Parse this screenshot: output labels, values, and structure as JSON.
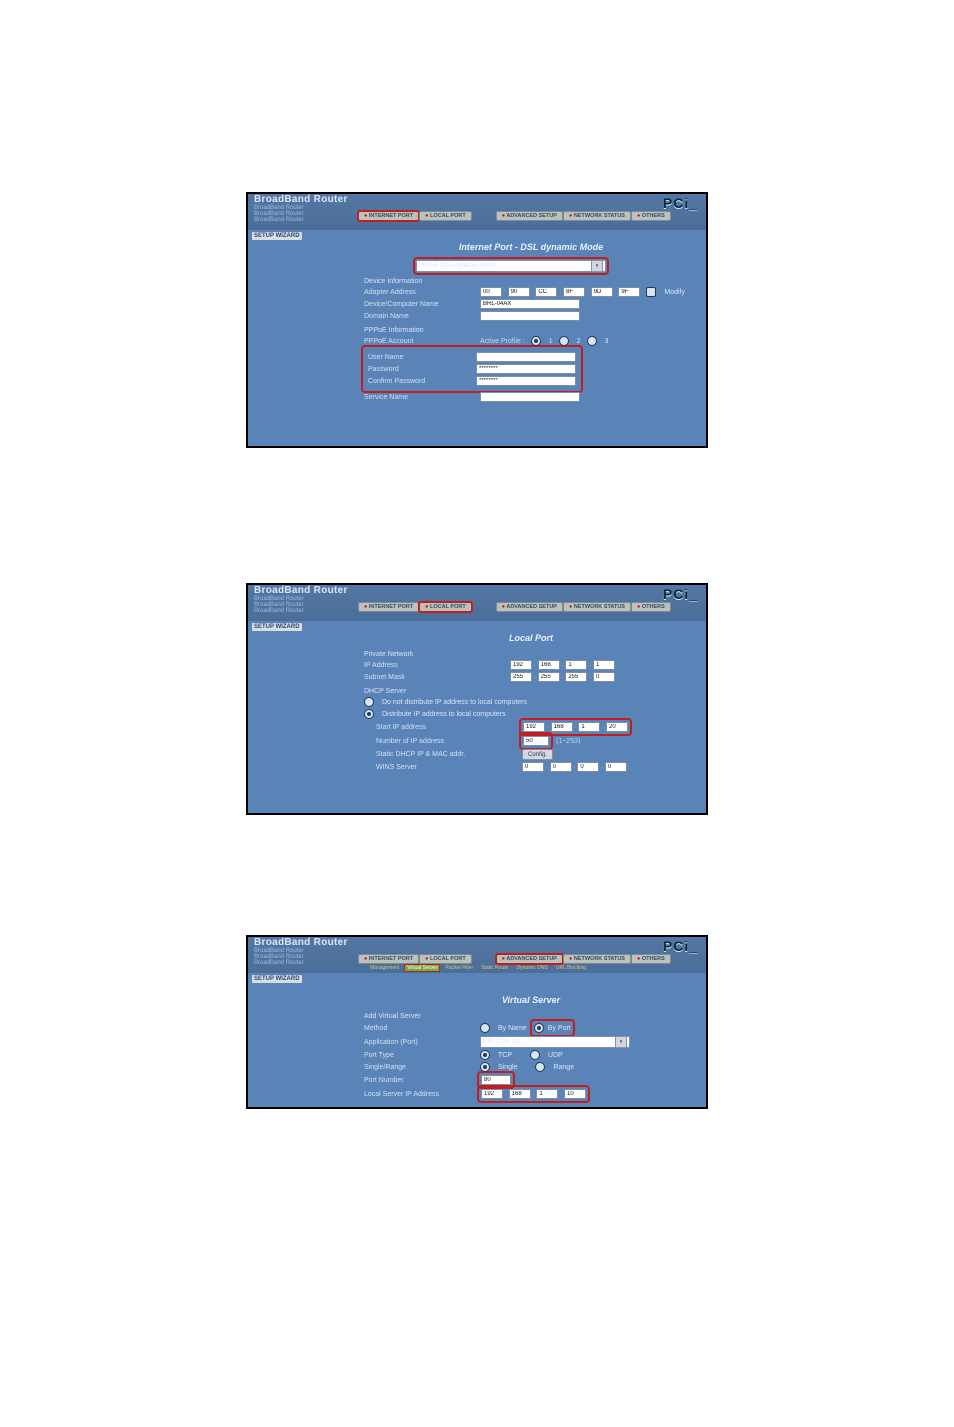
{
  "common": {
    "brand_main": "BroadBand Router",
    "brand_sub1": "BroadBand Router",
    "brand_sub2": "BroadBand Router",
    "brand_sub3": "BroadBand Router",
    "pci_logo": "PCi_",
    "setup_wizard": "SETUP WIZARD",
    "tabs": {
      "internet_port": "INTERNET PORT",
      "local_port": "LOCAL PORT",
      "advanced_setup": "ADVANCED SETUP",
      "network_status": "NETWORK STATUS",
      "others": "OTHERS"
    }
  },
  "fig1": {
    "title": "Internet Port - DSL dynamic Mode",
    "mode_select": "PPPoE (DSL dynamic mode)",
    "device_info_header": "Device Information",
    "adapter_address_label": "Adapter Address",
    "mac": {
      "a": "00",
      "b": "90",
      "c": "CC",
      "d": "8F",
      "e": "9D",
      "f": "9F"
    },
    "modify_label": "Modify",
    "device_name_label": "Device/Computer Name",
    "device_name_value": "BRL-04AX",
    "domain_name_label": "Domain Name",
    "domain_name_value": "",
    "pppoe_info_header": "PPPoE Information",
    "pppoe_account_label": "PPPoE Account",
    "active_profile_label": "Active Profile :",
    "profile1": "1",
    "profile2": "2",
    "profile3": "3",
    "user_name_label": "User Name",
    "user_name_value": "",
    "password_label": "Password",
    "password_value": "********",
    "confirm_password_label": "Confirm Password",
    "confirm_password_value": "********",
    "service_name_label": "Service Name",
    "service_name_value": ""
  },
  "fig2": {
    "title": "Local Port",
    "private_network_header": "Private Network",
    "ip_address_label": "IP Address",
    "ip": {
      "a": "192",
      "b": "168",
      "c": "1",
      "d": "1"
    },
    "subnet_label": "Subnet Mask",
    "mask": {
      "a": "255",
      "b": "255",
      "c": "255",
      "d": "0"
    },
    "dhcp_header": "DHCP Server",
    "dhcp_off_label": "Do not distribute IP address to local computers",
    "dhcp_on_label": "Distribute IP address to local computers",
    "start_ip_label": "Start IP address",
    "start_ip": {
      "a": "192",
      "b": "168",
      "c": "1",
      "d": "20"
    },
    "num_ip_label": "Number of IP address",
    "num_ip_value": "50",
    "num_ip_range": "(1~253)",
    "static_dhcp_label": "Static DHCP IP & MAC addr.",
    "config_btn": "Config.",
    "wins_label": "WINS Server",
    "wins": {
      "a": "0",
      "b": "0",
      "c": "0",
      "d": "0"
    }
  },
  "fig3": {
    "title": "Virtual Server",
    "subtabs": {
      "management": "Management",
      "virtual_server": "Virtual Server",
      "packet_filter": "Packet Filter",
      "static_route": "Static Route",
      "dynamic_dns": "Dynamic DNS",
      "url_blocking": "URL Blocking"
    },
    "add_header": "Add Virtual Server",
    "method_label": "Method",
    "by_name": "By Name",
    "by_port": "By Port",
    "app_port_label": "Application (Port)",
    "app_port_value": "FTP (TCP 21)",
    "port_type_label": "Port Type",
    "tcp": "TCP",
    "udp": "UDP",
    "single_range_label": "Single/Range",
    "single": "Single",
    "range": "Range",
    "port_number_label": "Port Number",
    "port_number_value": "80",
    "local_ip_label": "Local Server IP Address",
    "local_ip": {
      "a": "192",
      "b": "168",
      "c": "1",
      "d": "10"
    }
  }
}
